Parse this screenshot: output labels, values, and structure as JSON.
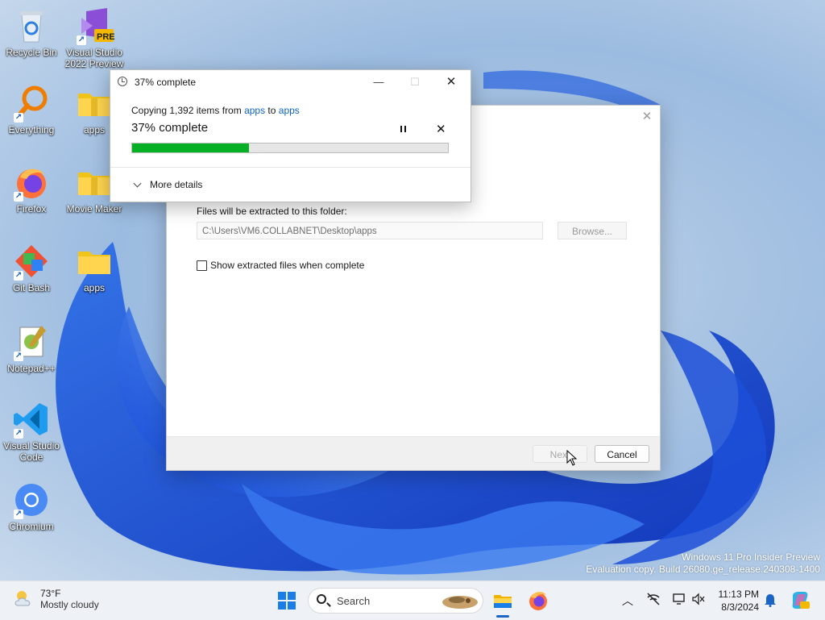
{
  "desktop": {
    "icons": [
      {
        "label": "Recycle Bin",
        "icon": "recycle-bin-icon"
      },
      {
        "label": "Visual Studio 2022 Preview",
        "icon": "visual-studio-preview-icon",
        "badge": "PRE"
      },
      {
        "label": "Everything",
        "icon": "everything-search-icon"
      },
      {
        "label": "apps",
        "icon": "folder-icon"
      },
      {
        "label": "Firefox",
        "icon": "firefox-icon"
      },
      {
        "label": "Movie Maker",
        "icon": "folder-icon"
      },
      {
        "label": "Git Bash",
        "icon": "git-bash-icon"
      },
      {
        "label": "apps",
        "icon": "folder-icon"
      },
      {
        "label": "Notepad++",
        "icon": "notepad-plus-plus-icon"
      },
      {
        "label": "Visual Studio Code",
        "icon": "vscode-icon"
      },
      {
        "label": "Chromium",
        "icon": "chromium-icon"
      }
    ],
    "watermark": {
      "line1": "Windows 11 Pro Insider Preview",
      "line2": "Evaluation copy. Build 26080.ge_release.240308-1400"
    }
  },
  "copy_dialog": {
    "title": "37% complete",
    "line_prefix": "Copying 1,392 items from ",
    "source": "apps",
    "line_mid": " to ",
    "destination": "apps",
    "status": "37% complete",
    "progress_percent": 37,
    "more_details": "More details",
    "accent_color": "#06b025"
  },
  "extract_wizard": {
    "folder_label": "Files will be extracted to this folder:",
    "folder_path": "C:\\Users\\VM6.COLLABNET\\Desktop\\apps",
    "browse_label": "Browse...",
    "checkbox_label": "Show extracted files when complete",
    "checkbox_checked": false,
    "next_label": "Next",
    "cancel_label": "Cancel"
  },
  "taskbar": {
    "weather_temp": "73°F",
    "weather_condition": "Mostly cloudy",
    "search_placeholder": "Search",
    "time": "11:13 PM",
    "date": "8/3/2024"
  }
}
